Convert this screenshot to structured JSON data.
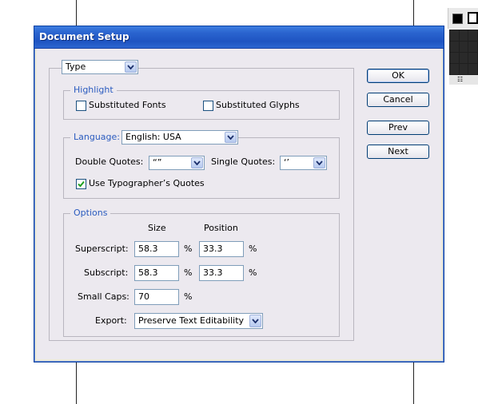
{
  "dialog": {
    "title": "Document Setup",
    "section_select": "Type"
  },
  "highlight": {
    "legend": "Highlight",
    "substituted_fonts": {
      "label": "Substituted Fonts",
      "checked": false
    },
    "substituted_glyphs": {
      "label": "Substituted Glyphs",
      "checked": false
    }
  },
  "language": {
    "legend": "Language:",
    "value": "English: USA",
    "double_quotes_label": "Double Quotes:",
    "double_quotes_value": "“”",
    "single_quotes_label": "Single Quotes:",
    "single_quotes_value": "‘’",
    "typographers_quotes": {
      "label": "Use Typographer’s Quotes",
      "checked": true
    }
  },
  "options": {
    "legend": "Options",
    "size_header": "Size",
    "position_header": "Position",
    "superscript": {
      "label": "Superscript:",
      "size": "58.3",
      "position": "33.3"
    },
    "subscript": {
      "label": "Subscript:",
      "size": "58.3",
      "position": "33.3"
    },
    "small_caps": {
      "label": "Small Caps:",
      "value": "70"
    },
    "percent": "%",
    "export": {
      "label": "Export:",
      "value": "Preserve Text Editability"
    }
  },
  "buttons": {
    "ok": "OK",
    "cancel": "Cancel",
    "prev": "Prev",
    "next": "Next"
  },
  "palette": {
    "table_icon_glyph": "☷"
  },
  "colors": {
    "titlebar": "#245edb",
    "legend_text": "#2a5bbf",
    "dialog_bg": "#ece9ef"
  }
}
